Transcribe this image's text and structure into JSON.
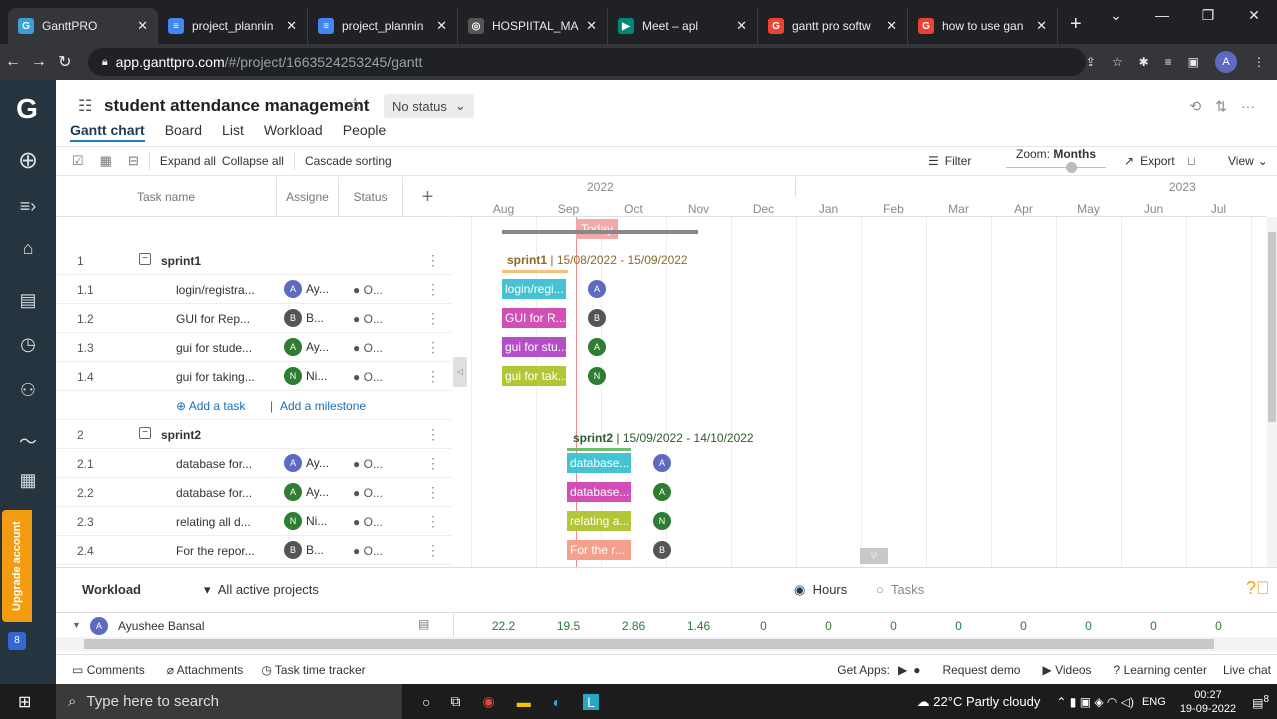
{
  "browser": {
    "tabs": [
      {
        "title": "GanttPRO",
        "fav": "G",
        "color": "#3aa0d8",
        "active": true
      },
      {
        "title": "project_plannin",
        "fav": "≡",
        "color": "#4285f4"
      },
      {
        "title": "project_plannin",
        "fav": "≡",
        "color": "#4285f4"
      },
      {
        "title": "HOSPIITAL_MA",
        "fav": "◎",
        "color": "#555"
      },
      {
        "title": "Meet – apl",
        "fav": "▶",
        "color": "#00897b"
      },
      {
        "title": "gantt pro softw",
        "fav": "G",
        "color": "#ea4335"
      },
      {
        "title": "how to use gan",
        "fav": "G",
        "color": "#ea4335"
      }
    ],
    "url_domain": "app.ganttpro.com",
    "url_path": "/#/project/1663524253245/gantt",
    "profile": "A"
  },
  "sidebar": {
    "logo": "G",
    "upgrade": "Upgrade account",
    "notif": "8"
  },
  "project": {
    "title": "student attendance management",
    "status": "No status"
  },
  "views": [
    "Gantt chart",
    "Board",
    "List",
    "Workload",
    "People"
  ],
  "toolbar": {
    "expand": "Expand all",
    "collapse": "Collapse all",
    "cascade": "Cascade sorting",
    "filter": "Filter",
    "zoom_label": "Zoom:",
    "zoom_value": "Months",
    "export": "Export",
    "view": "View"
  },
  "grid_head": {
    "task": "Task name",
    "assignee": "Assigne",
    "status": "Status"
  },
  "rows": [
    {
      "num": "1",
      "name": "sprint1",
      "type": "group"
    },
    {
      "num": "1.1",
      "name": "login/registra...",
      "av": "A",
      "avc": "blue",
      "asg": "Ay...",
      "st": "● O..."
    },
    {
      "num": "1.2",
      "name": "GUI for Rep...",
      "av": "B",
      "avc": "dark",
      "asg": "B...",
      "st": "● O..."
    },
    {
      "num": "1.3",
      "name": "gui for stude...",
      "av": "A",
      "avc": "green",
      "asg": "Ay...",
      "st": "● O..."
    },
    {
      "num": "1.4",
      "name": "gui for taking...",
      "av": "N",
      "avc": "green",
      "asg": "Ni...",
      "st": "● O..."
    },
    {
      "type": "add",
      "add_task": "Add a task",
      "add_ms": "Add a milestone"
    },
    {
      "num": "2",
      "name": "sprint2",
      "type": "group"
    },
    {
      "num": "2.1",
      "name": "database for...",
      "av": "A",
      "avc": "blue",
      "asg": "Ay...",
      "st": "● O..."
    },
    {
      "num": "2.2",
      "name": "database for...",
      "av": "A",
      "avc": "green",
      "asg": "Ay...",
      "st": "● O..."
    },
    {
      "num": "2.3",
      "name": "relating all d...",
      "av": "N",
      "avc": "green",
      "asg": "Ni...",
      "st": "● O..."
    },
    {
      "num": "2.4",
      "name": "For the repor...",
      "av": "B",
      "avc": "dark",
      "asg": "B...",
      "st": "● O..."
    }
  ],
  "timeline": {
    "years": [
      "2022",
      "2023"
    ],
    "months": [
      "Aug",
      "Sep",
      "Oct",
      "Nov",
      "Dec",
      "Jan",
      "Feb",
      "Mar",
      "Apr",
      "May",
      "Jun",
      "Jul"
    ],
    "today": "Today"
  },
  "gantt": {
    "sprint1_name": "sprint1",
    "sprint1_dates": "15/08/2022 - 15/09/2022",
    "sprint2_name": "sprint2",
    "sprint2_dates": "15/09/2022 - 14/10/2022",
    "bars": [
      {
        "label": "login/regi...",
        "color": "#44c3d5",
        "av": "A",
        "avc": "blue"
      },
      {
        "label": "GUI for R...",
        "color": "#d24fb6",
        "av": "B",
        "avc": "dark"
      },
      {
        "label": "gui for stu...",
        "color": "#b44fc7",
        "av": "A",
        "avc": "green"
      },
      {
        "label": "gui for tak...",
        "color": "#b3c637",
        "av": "N",
        "avc": "green"
      },
      {
        "label": "database...",
        "color": "#44c3d5",
        "av": "A",
        "avc": "blue"
      },
      {
        "label": "database...",
        "color": "#d24fb6",
        "av": "A",
        "avc": "green"
      },
      {
        "label": "relating a...",
        "color": "#b3c637",
        "av": "N",
        "avc": "green"
      },
      {
        "label": "For the r...",
        "color": "#f4a08c",
        "av": "B",
        "avc": "dark"
      }
    ]
  },
  "workload": {
    "title": "Workload",
    "filter": "All active projects",
    "hours": "Hours",
    "tasks": "Tasks",
    "person": "Ayushee Bansal",
    "values": [
      "22.2",
      "19.5",
      "2.86",
      "1.46",
      "0",
      "0",
      "0",
      "0",
      "0",
      "0",
      "0",
      "0"
    ]
  },
  "bottom": {
    "comments": "Comments",
    "attachments": "Attachments",
    "tracker": "Task time tracker",
    "getapps": "Get Apps:",
    "demo": "Request demo",
    "videos": "Videos",
    "learning": "Learning center",
    "chat": "Live chat"
  },
  "taskbar": {
    "search": "Type here to search",
    "weather": "22°C  Partly cloudy",
    "lang": "ENG",
    "time": "00:27",
    "date": "19-09-2022",
    "notif": "8"
  }
}
